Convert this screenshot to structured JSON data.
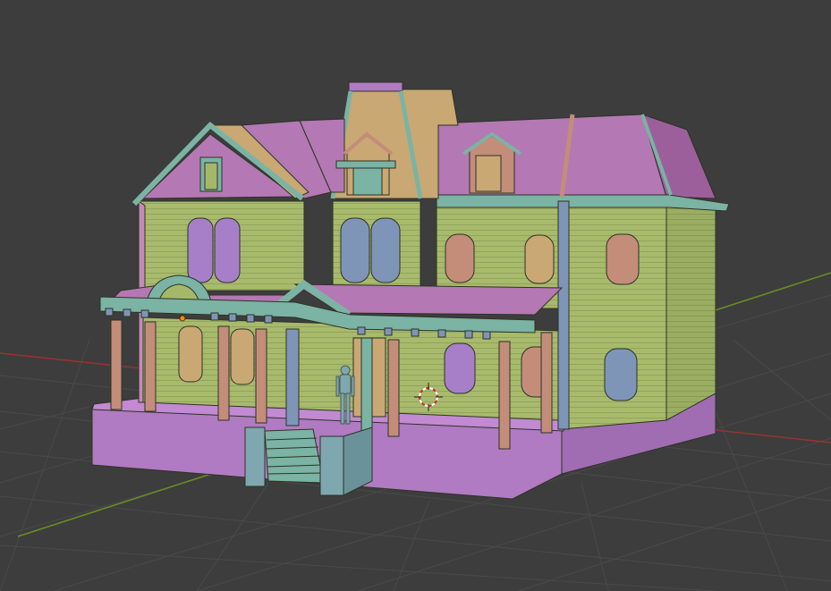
{
  "viewport": {
    "mode": "3d-viewport",
    "shading": "solid-random-color",
    "background_color": "#3d3d3d",
    "grid_color": "#505050",
    "x_axis_color": "#9b3232",
    "y_axis_color": "#6b8e23"
  },
  "scene": {
    "objects": [
      "house-model",
      "human-reference-figure",
      "origin-point"
    ],
    "cursor": "3d-cursor-icon",
    "palette": {
      "wall_green": "#a5b86a",
      "roof_purple": "#b478b4",
      "teal": "#7bb3a4",
      "blue": "#7f95b7",
      "salmon": "#c38d7a",
      "tan": "#c9a874",
      "foundation_purple": "#b07bc2",
      "origin_orange": "#ff8c00"
    }
  }
}
